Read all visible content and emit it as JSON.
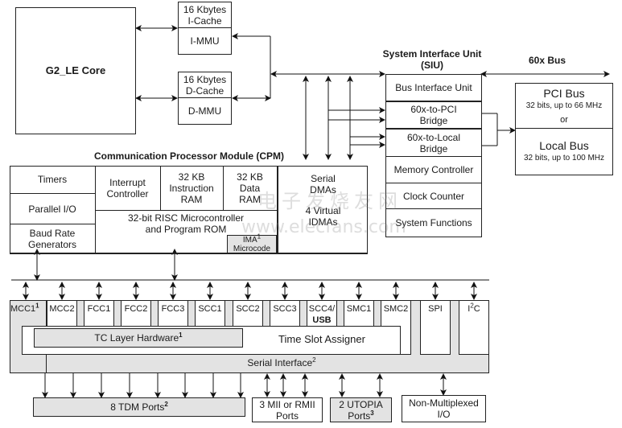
{
  "core": {
    "label": "G2_LE Core"
  },
  "icache": {
    "size": "16 Kbytes",
    "name": "I-Cache",
    "mmu": "I-MMU"
  },
  "dcache": {
    "size": "16 Kbytes",
    "name": "D-Cache",
    "mmu": "D-MMU"
  },
  "siu": {
    "title_line1": "System Interface Unit",
    "title_line2": "(SIU)",
    "blocks": [
      "Bus Interface Unit",
      "60x-to-PCI Bridge",
      "60x-to-Local Bridge",
      "Memory Controller",
      "Clock Counter",
      "System Functions"
    ],
    "pci_line1": "60x-to-PCI",
    "pci_line2": "Bridge",
    "local_line1": "60x-to-Local",
    "local_line2": "Bridge"
  },
  "bus60x": {
    "label": "60x Bus"
  },
  "external_bus": {
    "pci_title": "PCI Bus",
    "pci_desc": "32 bits, up to 66 MHz",
    "or": "or",
    "local_title": "Local Bus",
    "local_desc": "32 bits, up to 100 MHz"
  },
  "cpm": {
    "title": "Communication Processor Module (CPM)",
    "timers": "Timers",
    "parallel_io": "Parallel I/O",
    "baud_line1": "Baud Rate",
    "baud_line2": "Generators",
    "interrupt_line1": "Interrupt",
    "interrupt_line2": "Controller",
    "iram_line1": "32 KB",
    "iram_line2": "Instruction",
    "iram_line3": "RAM",
    "dram_line1": "32 KB",
    "dram_line2": "Data",
    "dram_line3": "RAM",
    "risc_line1": "32-bit RISC Microcontroller",
    "risc_line2": "and Program ROM",
    "ima_line1": "IMA",
    "ima_sup": "1",
    "ima_line2": "Microcode",
    "sdma_line1": "Serial",
    "sdma_line2": "DMAs",
    "sdma_line3": "4 Virtual",
    "sdma_line4": "IDMAs"
  },
  "controllers": [
    {
      "label": "MCC1",
      "sup": "1"
    },
    {
      "label": "MCC2"
    },
    {
      "label": "FCC1"
    },
    {
      "label": "FCC2"
    },
    {
      "label": "FCC3"
    },
    {
      "label": "SCC1"
    },
    {
      "label": "SCC2"
    },
    {
      "label": "SCC3"
    },
    {
      "label": "SCC4/",
      "label2": "USB"
    },
    {
      "label": "SMC1"
    },
    {
      "label": "SMC2"
    },
    {
      "label": "SPI"
    },
    {
      "label": "I",
      "sup": "2",
      "label_tail": "C"
    }
  ],
  "tc_layer": {
    "label": "TC Layer Hardware",
    "sup": "1"
  },
  "tsa": {
    "label": "Time Slot Assigner"
  },
  "serial_interface": {
    "label": "Serial Interface",
    "sup": "2"
  },
  "ports": {
    "tdm": {
      "label": "8 TDM Ports",
      "sup": "2"
    },
    "mii_line1": "3 MII or RMII",
    "mii_line2": "Ports",
    "utopia_line1": "2 UTOPIA",
    "utopia_line2": "Ports",
    "utopia_sup": "3",
    "nonmux_line1": "Non-Multiplexed",
    "nonmux_line2": "I/O"
  },
  "watermark": {
    "cn": "电子发烧友网",
    "url": "www.elecfans.com"
  }
}
